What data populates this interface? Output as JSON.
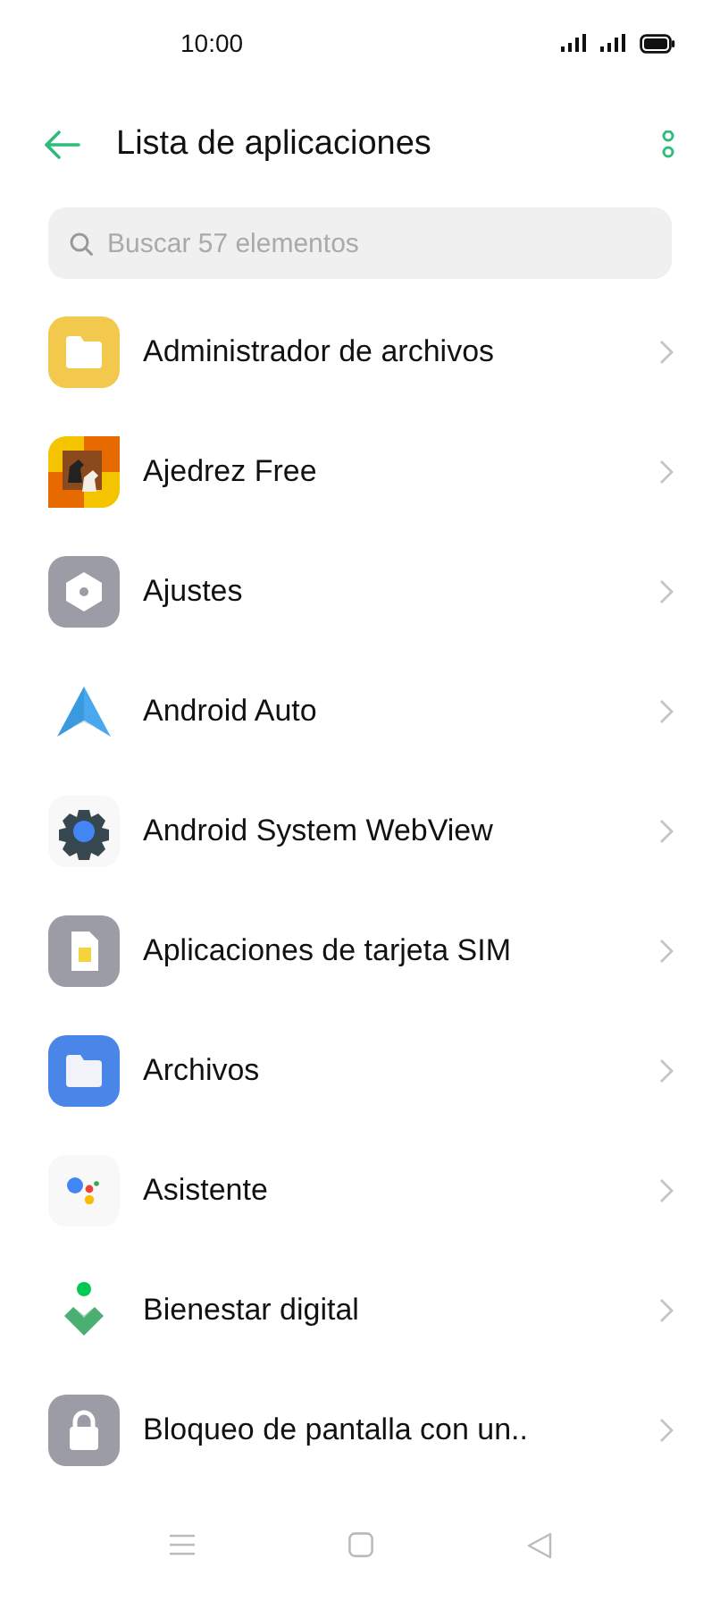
{
  "status_bar": {
    "time": "10:00"
  },
  "header": {
    "title": "Lista de aplicaciones"
  },
  "search": {
    "placeholder": "Buscar 57 elementos"
  },
  "apps": [
    {
      "name": "Administrador de archivos"
    },
    {
      "name": "Ajedrez Free"
    },
    {
      "name": "Ajustes"
    },
    {
      "name": "Android Auto"
    },
    {
      "name": "Android System WebView"
    },
    {
      "name": "Aplicaciones de tarjeta SIM"
    },
    {
      "name": "Archivos"
    },
    {
      "name": "Asistente"
    },
    {
      "name": "Bienestar digital"
    },
    {
      "name": "Bloqueo de pantalla con un.."
    }
  ]
}
